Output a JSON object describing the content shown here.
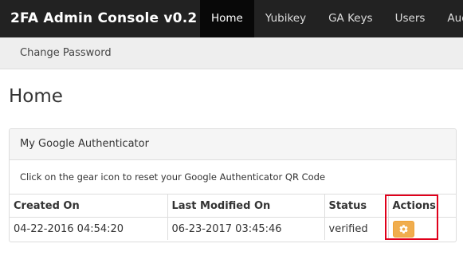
{
  "navbar": {
    "brand": "2FA Admin Console v0.2",
    "items": [
      {
        "label": "Home",
        "active": true
      },
      {
        "label": "Yubikey",
        "active": false
      },
      {
        "label": "GA Keys",
        "active": false
      },
      {
        "label": "Users",
        "active": false
      },
      {
        "label": "Audi",
        "active": false
      }
    ]
  },
  "subnav": {
    "items": [
      {
        "label": "Change Password"
      }
    ]
  },
  "page": {
    "title": "Home"
  },
  "panel": {
    "heading": "My Google Authenticator",
    "body_text": "Click on the gear icon to reset your Google Authenticator QR Code",
    "table": {
      "headers": [
        "Created On",
        "Last Modified On",
        "Status",
        "Actions"
      ],
      "rows": [
        {
          "created_on": "04-22-2016 04:54:20",
          "last_modified_on": "06-23-2017 03:45:46",
          "status": "verified",
          "action_icon": "gear-icon"
        }
      ]
    }
  },
  "colors": {
    "navbar_bg": "#222222",
    "action_button": "#f0ad4e",
    "highlight": "#e0001b"
  }
}
